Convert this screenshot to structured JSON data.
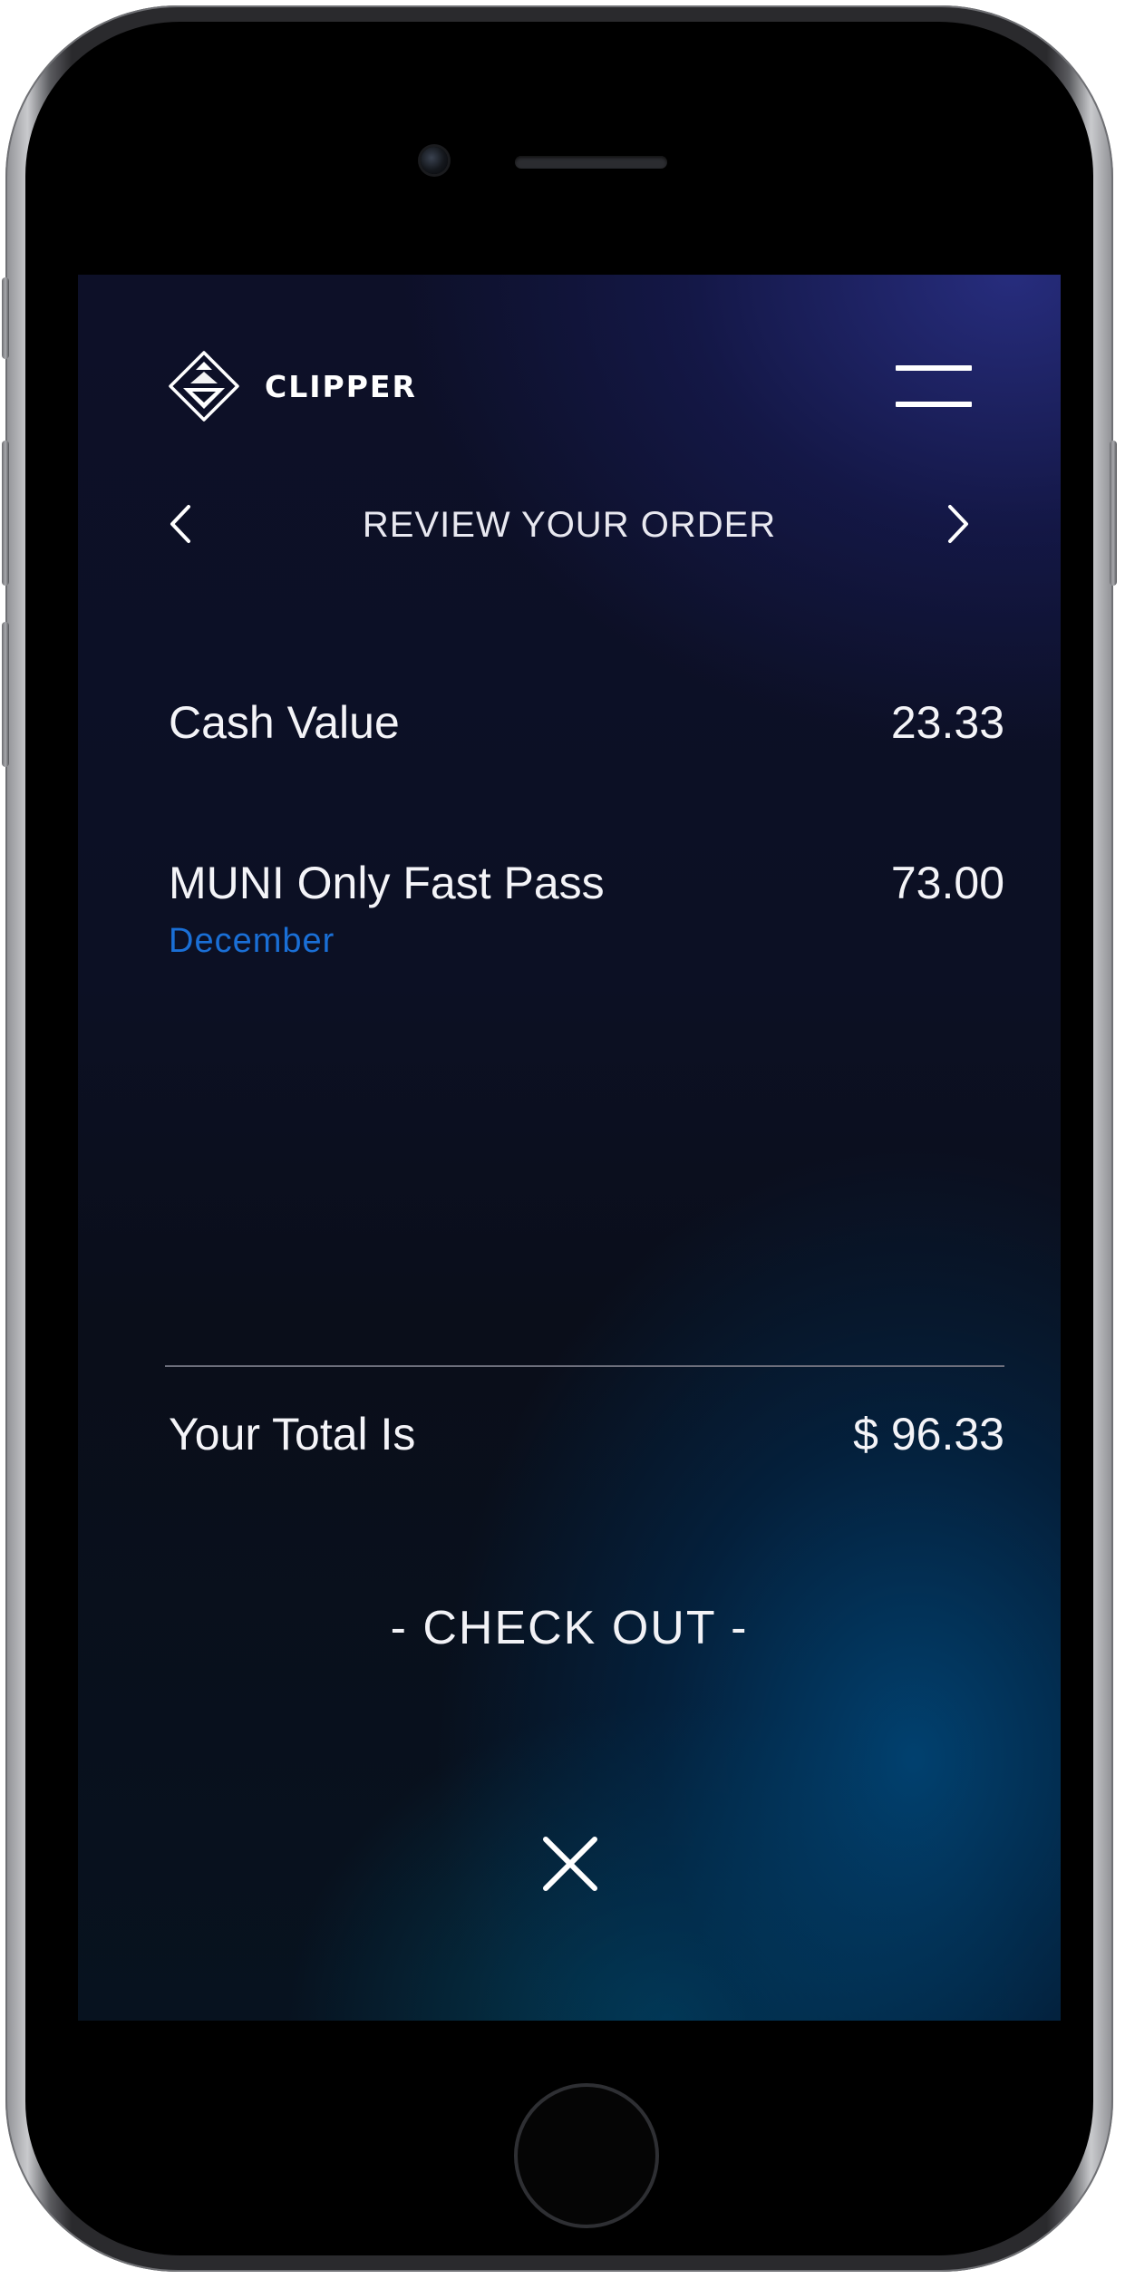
{
  "app": {
    "brand_name": "CLIPPER"
  },
  "header": {
    "menu_icon": "hamburger-menu-icon",
    "logo_icon": "clipper-diamond-logo-icon"
  },
  "nav": {
    "title": "REVIEW YOUR ORDER",
    "prev_icon": "chevron-left-icon",
    "next_icon": "chevron-right-icon"
  },
  "order": {
    "items": [
      {
        "label": "Cash Value",
        "amount": "23.33"
      },
      {
        "label": "MUNI Only Fast Pass",
        "amount": "73.00",
        "detail": "December"
      }
    ],
    "total_label": "Your Total Is",
    "total_amount": "$ 96.33"
  },
  "actions": {
    "checkout_label": "- CHECK OUT -",
    "close_icon": "close-x-icon"
  },
  "colors": {
    "accent": "#1a6fd6",
    "text": "#ffffff",
    "background_top": "#0d1028",
    "background_bottom": "#07121f"
  }
}
